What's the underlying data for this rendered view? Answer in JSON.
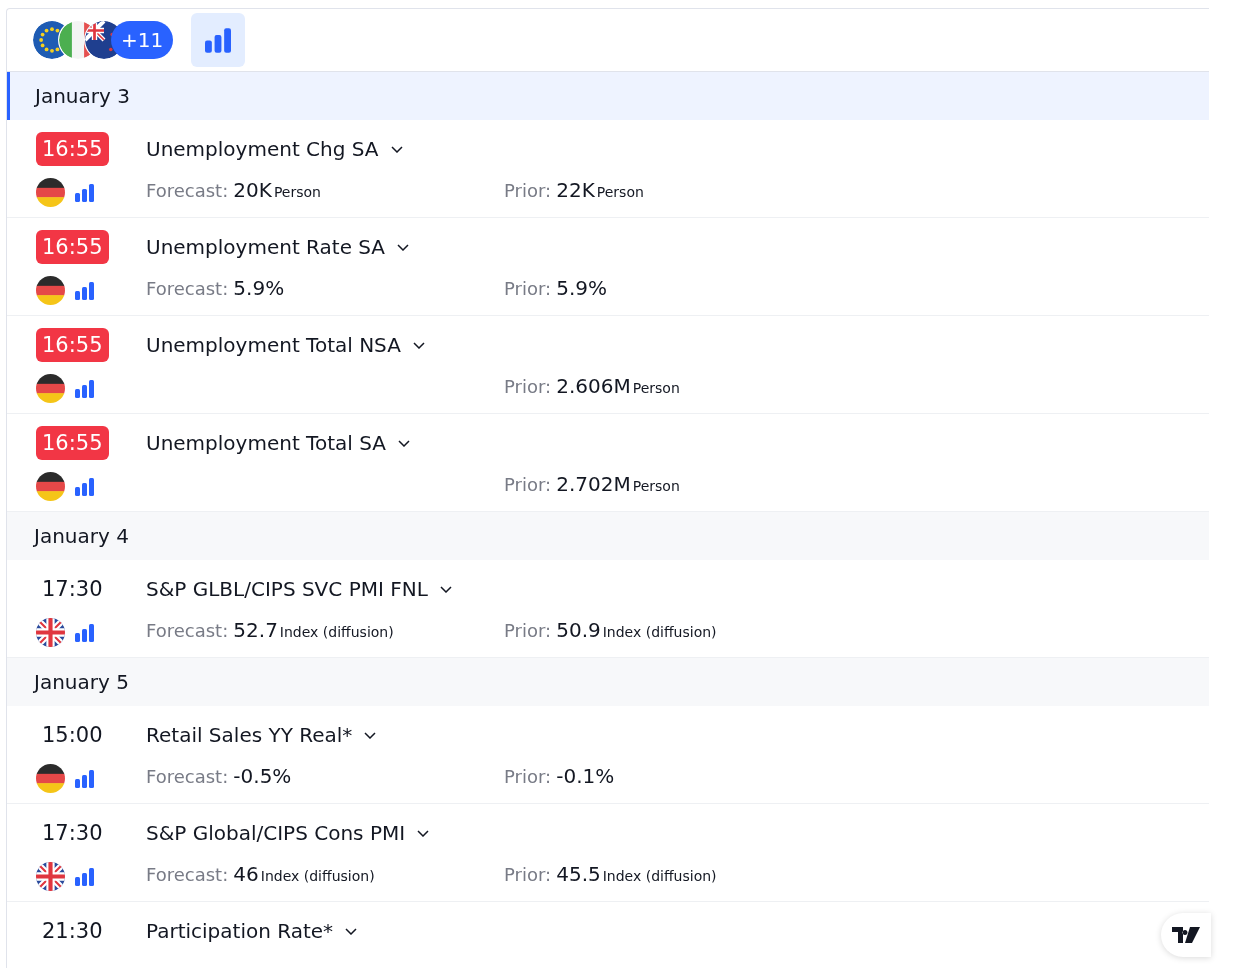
{
  "filters": {
    "flags": [
      {
        "kind": "eu"
      },
      {
        "kind": "it"
      },
      {
        "kind": "nz"
      }
    ],
    "more_count": "+11",
    "importance_filter": {
      "selected": true
    }
  },
  "days": [
    {
      "label": "January 3",
      "current": true,
      "events": [
        {
          "time": "16:55",
          "highlighted": true,
          "flags": [
            {
              "kind": "de"
            }
          ],
          "name": "Unemployment Chg SA",
          "forecast": {
            "label": "Forecast:",
            "value": "20K",
            "unit": "Person"
          },
          "prior": {
            "label": "Prior:",
            "value": "22K",
            "unit": "Person"
          }
        },
        {
          "time": "16:55",
          "highlighted": true,
          "flags": [
            {
              "kind": "de"
            }
          ],
          "name": "Unemployment Rate SA",
          "forecast": {
            "label": "Forecast:",
            "value": "5.9%"
          },
          "prior": {
            "label": "Prior:",
            "value": "5.9%"
          }
        },
        {
          "time": "16:55",
          "highlighted": true,
          "flags": [
            {
              "kind": "de"
            }
          ],
          "name": "Unemployment Total NSA",
          "prior": {
            "label": "Prior:",
            "value": "2.606M",
            "unit": "Person"
          }
        },
        {
          "time": "16:55",
          "highlighted": true,
          "flags": [
            {
              "kind": "de"
            }
          ],
          "name": "Unemployment Total SA",
          "prior": {
            "label": "Prior:",
            "value": "2.702M",
            "unit": "Person"
          }
        }
      ]
    },
    {
      "label": "January 4",
      "current": false,
      "events": [
        {
          "time": "17:30",
          "highlighted": false,
          "flags": [
            {
              "kind": "gb"
            }
          ],
          "name": "S&P GLBL/CIPS SVC PMI FNL",
          "forecast": {
            "label": "Forecast:",
            "value": "52.7",
            "unit": "Index (diffusion)"
          },
          "prior": {
            "label": "Prior:",
            "value": "50.9",
            "unit": "Index (diffusion)"
          }
        }
      ]
    },
    {
      "label": "January 5",
      "current": false,
      "events": [
        {
          "time": "15:00",
          "highlighted": false,
          "flags": [
            {
              "kind": "de"
            }
          ],
          "name": "Retail Sales YY Real*",
          "forecast": {
            "label": "Forecast:",
            "value": "-0.5%"
          },
          "prior": {
            "label": "Prior:",
            "value": "-0.1%"
          }
        },
        {
          "time": "17:30",
          "highlighted": false,
          "flags": [
            {
              "kind": "gb"
            }
          ],
          "name": "S&P Global/CIPS Cons PMI",
          "forecast": {
            "label": "Forecast:",
            "value": "46",
            "unit": "Index (diffusion)"
          },
          "prior": {
            "label": "Prior:",
            "value": "45.5",
            "unit": "Index (diffusion)"
          }
        },
        {
          "time": "21:30",
          "highlighted": false,
          "name": "Participation Rate*"
        }
      ]
    }
  ]
}
